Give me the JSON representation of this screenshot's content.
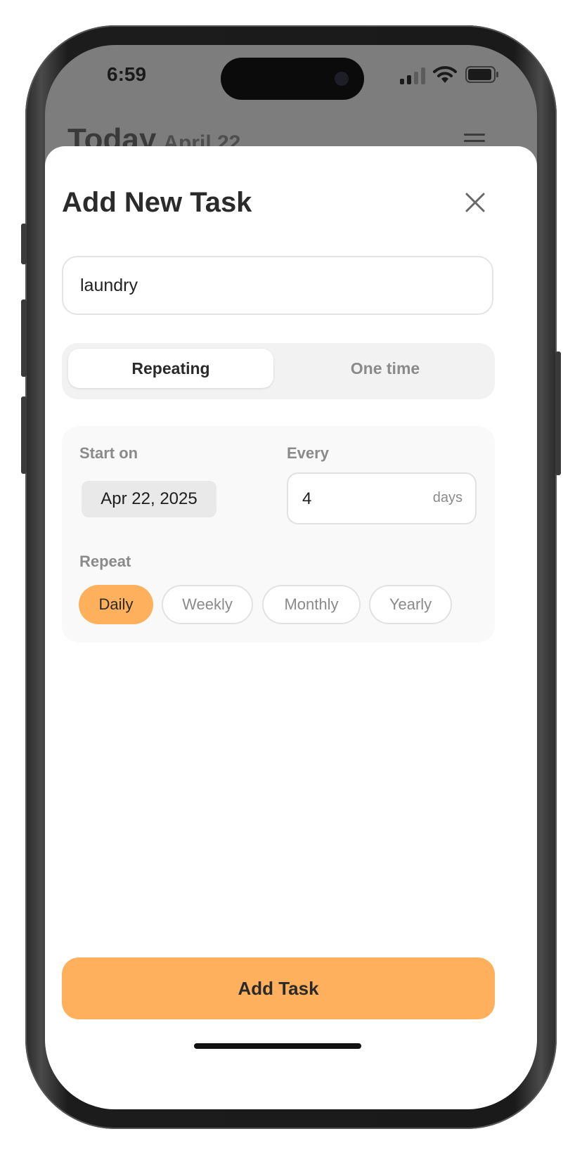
{
  "status_bar": {
    "time": "6:59",
    "icons": [
      "cellular-signal-icon",
      "wifi-icon",
      "battery-icon"
    ]
  },
  "background_screen": {
    "title": "Today",
    "subtitle": "April 22",
    "menu_icon": "hamburger-menu-icon"
  },
  "sheet": {
    "title": "Add New Task",
    "close_icon": "close-icon",
    "task_name": {
      "value": "laundry",
      "placeholder": ""
    },
    "task_type": {
      "options": [
        "Repeating",
        "One time"
      ],
      "selected": "Repeating"
    },
    "schedule": {
      "start_on_label": "Start on",
      "start_date": "Apr 22, 2025",
      "every_label": "Every",
      "every_value": "4",
      "every_unit": "days",
      "repeat_label": "Repeat",
      "repeat_options": [
        "Daily",
        "Weekly",
        "Monthly",
        "Yearly"
      ],
      "repeat_selected": "Daily"
    },
    "submit_label": "Add Task"
  },
  "colors": {
    "accent": "#ffb05c",
    "dim_overlay": "#7d7d7d",
    "card_background": "#f9f9f9",
    "segment_background": "#f2f2f2",
    "muted_text": "#8a8a8a",
    "primary_text": "#2b2b2b"
  }
}
